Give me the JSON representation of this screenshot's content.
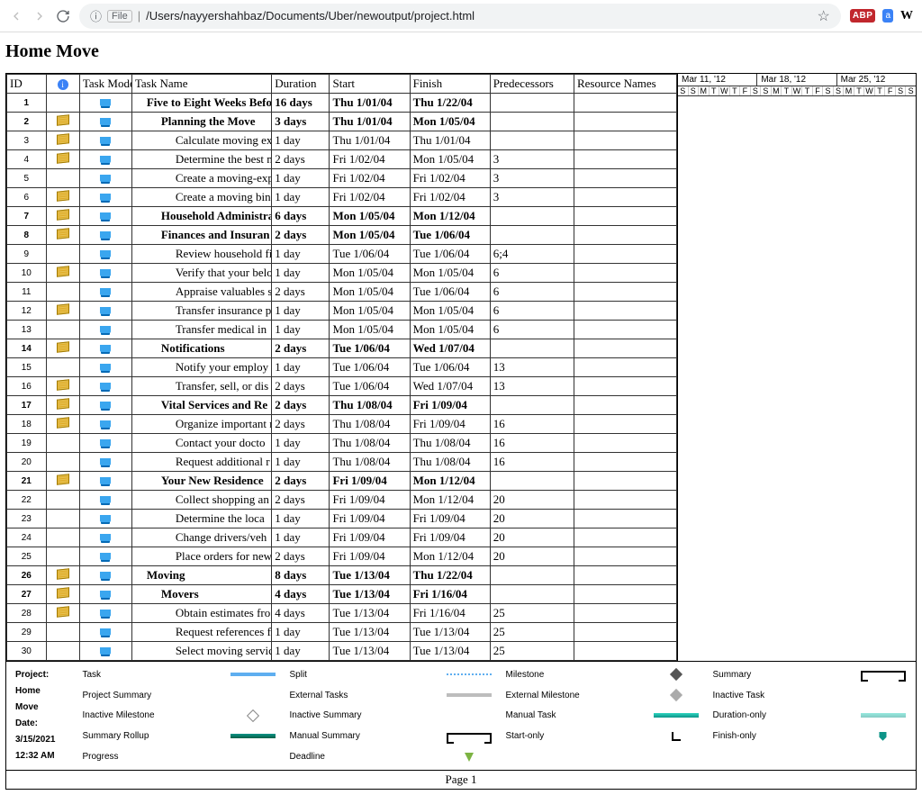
{
  "browser": {
    "url_prefix": "File",
    "path": "/Users/nayyershahbaz/Documents/Uber/newoutput/project.html"
  },
  "title": "Home Move",
  "columns": {
    "id": "ID",
    "info": "",
    "mode": "Task Mode",
    "name": "Task Name",
    "duration": "Duration",
    "start": "Start",
    "finish": "Finish",
    "pred": "Predecessors",
    "res": "Resource Names"
  },
  "gantt": {
    "months": [
      "Mar 11, '12",
      "Mar 18, '12",
      "Mar 25, '12"
    ],
    "days_pattern": [
      "S",
      "S",
      "M",
      "T",
      "W",
      "T",
      "F",
      "S",
      "S",
      "M",
      "T",
      "W",
      "T",
      "F",
      "S",
      "S",
      "M",
      "T",
      "W",
      "T",
      "F",
      "S",
      "S"
    ]
  },
  "rows": [
    {
      "id": "1",
      "note": false,
      "bold": true,
      "indent": 1,
      "name": "Five to Eight Weeks Befo",
      "dur": "16 days",
      "start": "Thu 1/01/04",
      "finish": "Thu 1/22/04",
      "pred": ""
    },
    {
      "id": "2",
      "note": true,
      "bold": true,
      "indent": 2,
      "name": "Planning the Move",
      "dur": "3 days",
      "start": "Thu 1/01/04",
      "finish": "Mon 1/05/04",
      "pred": ""
    },
    {
      "id": "3",
      "note": true,
      "bold": false,
      "indent": 3,
      "name": "Calculate moving exp",
      "dur": "1 day",
      "start": "Thu 1/01/04",
      "finish": "Thu 1/01/04",
      "pred": ""
    },
    {
      "id": "4",
      "note": true,
      "bold": false,
      "indent": 3,
      "name": "Determine the best m",
      "dur": "2 days",
      "start": "Fri 1/02/04",
      "finish": "Mon 1/05/04",
      "pred": "3"
    },
    {
      "id": "5",
      "note": false,
      "bold": false,
      "indent": 3,
      "name": "Create a moving-expe",
      "dur": "1 day",
      "start": "Fri 1/02/04",
      "finish": "Fri 1/02/04",
      "pred": "3"
    },
    {
      "id": "6",
      "note": true,
      "bold": false,
      "indent": 3,
      "name": "Create a moving bind",
      "dur": "1 day",
      "start": "Fri 1/02/04",
      "finish": "Fri 1/02/04",
      "pred": "3"
    },
    {
      "id": "7",
      "note": true,
      "bold": true,
      "indent": 2,
      "name": "Household Administratio",
      "dur": "6 days",
      "start": "Mon 1/05/04",
      "finish": "Mon 1/12/04",
      "pred": ""
    },
    {
      "id": "8",
      "note": true,
      "bold": true,
      "indent": 2,
      "name": "Finances and Insuran",
      "dur": "2 days",
      "start": "Mon 1/05/04",
      "finish": "Tue 1/06/04",
      "pred": ""
    },
    {
      "id": "9",
      "note": false,
      "bold": false,
      "indent": 3,
      "name": "Review household fin",
      "dur": "1 day",
      "start": "Tue 1/06/04",
      "finish": "Tue 1/06/04",
      "pred": "6;4"
    },
    {
      "id": "10",
      "note": true,
      "bold": false,
      "indent": 3,
      "name": "Verify that your belo",
      "dur": "1 day",
      "start": "Mon 1/05/04",
      "finish": "Mon 1/05/04",
      "pred": "6"
    },
    {
      "id": "11",
      "note": false,
      "bold": false,
      "indent": 3,
      "name": "Appraise valuables s",
      "dur": "2 days",
      "start": "Mon 1/05/04",
      "finish": "Tue 1/06/04",
      "pred": "6"
    },
    {
      "id": "12",
      "note": true,
      "bold": false,
      "indent": 3,
      "name": "Transfer insurance p",
      "dur": "1 day",
      "start": "Mon 1/05/04",
      "finish": "Mon 1/05/04",
      "pred": "6"
    },
    {
      "id": "13",
      "note": false,
      "bold": false,
      "indent": 3,
      "name": "Transfer medical in",
      "dur": "1 day",
      "start": "Mon 1/05/04",
      "finish": "Mon 1/05/04",
      "pred": "6"
    },
    {
      "id": "14",
      "note": true,
      "bold": true,
      "indent": 2,
      "name": "Notifications",
      "dur": "2 days",
      "start": "Tue 1/06/04",
      "finish": "Wed 1/07/04",
      "pred": ""
    },
    {
      "id": "15",
      "note": false,
      "bold": false,
      "indent": 3,
      "name": "Notify your employ",
      "dur": "1 day",
      "start": "Tue 1/06/04",
      "finish": "Tue 1/06/04",
      "pred": "13"
    },
    {
      "id": "16",
      "note": true,
      "bold": false,
      "indent": 3,
      "name": "Transfer, sell, or dis",
      "dur": "2 days",
      "start": "Tue 1/06/04",
      "finish": "Wed 1/07/04",
      "pred": "13"
    },
    {
      "id": "17",
      "note": true,
      "bold": true,
      "indent": 2,
      "name": "Vital Services and Re",
      "dur": "2 days",
      "start": "Thu 1/08/04",
      "finish": "Fri 1/09/04",
      "pred": ""
    },
    {
      "id": "18",
      "note": true,
      "bold": false,
      "indent": 3,
      "name": "Organize important r",
      "dur": "2 days",
      "start": "Thu 1/08/04",
      "finish": "Fri 1/09/04",
      "pred": "16"
    },
    {
      "id": "19",
      "note": false,
      "bold": false,
      "indent": 3,
      "name": "Contact your docto",
      "dur": "1 day",
      "start": "Thu 1/08/04",
      "finish": "Thu 1/08/04",
      "pred": "16"
    },
    {
      "id": "20",
      "note": false,
      "bold": false,
      "indent": 3,
      "name": "Request additional r",
      "dur": "1 day",
      "start": "Thu 1/08/04",
      "finish": "Thu 1/08/04",
      "pred": "16"
    },
    {
      "id": "21",
      "note": true,
      "bold": true,
      "indent": 2,
      "name": "Your New Residence",
      "dur": "2 days",
      "start": "Fri 1/09/04",
      "finish": "Mon 1/12/04",
      "pred": ""
    },
    {
      "id": "22",
      "note": false,
      "bold": false,
      "indent": 3,
      "name": "Collect shopping an",
      "dur": "2 days",
      "start": "Fri 1/09/04",
      "finish": "Mon 1/12/04",
      "pred": "20"
    },
    {
      "id": "23",
      "note": false,
      "bold": false,
      "indent": 3,
      "name": "Determine the loca",
      "dur": "1 day",
      "start": "Fri 1/09/04",
      "finish": "Fri 1/09/04",
      "pred": "20"
    },
    {
      "id": "24",
      "note": false,
      "bold": false,
      "indent": 3,
      "name": "Change drivers/veh",
      "dur": "1 day",
      "start": "Fri 1/09/04",
      "finish": "Fri 1/09/04",
      "pred": "20"
    },
    {
      "id": "25",
      "note": false,
      "bold": false,
      "indent": 3,
      "name": "Place orders for new",
      "dur": "2 days",
      "start": "Fri 1/09/04",
      "finish": "Mon 1/12/04",
      "pred": "20"
    },
    {
      "id": "26",
      "note": true,
      "bold": true,
      "indent": 1,
      "name": "Moving",
      "dur": "8 days",
      "start": "Tue 1/13/04",
      "finish": "Thu 1/22/04",
      "pred": ""
    },
    {
      "id": "27",
      "note": true,
      "bold": true,
      "indent": 2,
      "name": "Movers",
      "dur": "4 days",
      "start": "Tue 1/13/04",
      "finish": "Fri 1/16/04",
      "pred": ""
    },
    {
      "id": "28",
      "note": true,
      "bold": false,
      "indent": 3,
      "name": "Obtain estimates fro",
      "dur": "4 days",
      "start": "Tue 1/13/04",
      "finish": "Fri 1/16/04",
      "pred": "25"
    },
    {
      "id": "29",
      "note": false,
      "bold": false,
      "indent": 3,
      "name": "Request references f",
      "dur": "1 day",
      "start": "Tue 1/13/04",
      "finish": "Tue 1/13/04",
      "pred": "25"
    },
    {
      "id": "30",
      "note": false,
      "bold": false,
      "indent": 3,
      "name": "Select moving servic",
      "dur": "1 day",
      "start": "Tue 1/13/04",
      "finish": "Tue 1/13/04",
      "pred": "25"
    }
  ],
  "legend": {
    "project_label": "Project: Home Move",
    "date_label": "Date: 3/15/2021 12:32 AM",
    "items": {
      "task": "Task",
      "split": "Split",
      "milestone": "Milestone",
      "summary": "Summary",
      "project_summary": "Project Summary",
      "ext_tasks": "External Tasks",
      "ext_milestone": "External Milestone",
      "inactive_task": "Inactive Task",
      "inactive_milestone": "Inactive Milestone",
      "inactive_summary": "Inactive Summary",
      "manual_task": "Manual Task",
      "duration_only": "Duration-only",
      "summary_rollup": "Summary Rollup",
      "manual_summary": "Manual Summary",
      "start_only": "Start-only",
      "finish_only": "Finish-only",
      "progress": "Progress",
      "deadline": "Deadline"
    }
  },
  "footer": "Page 1"
}
